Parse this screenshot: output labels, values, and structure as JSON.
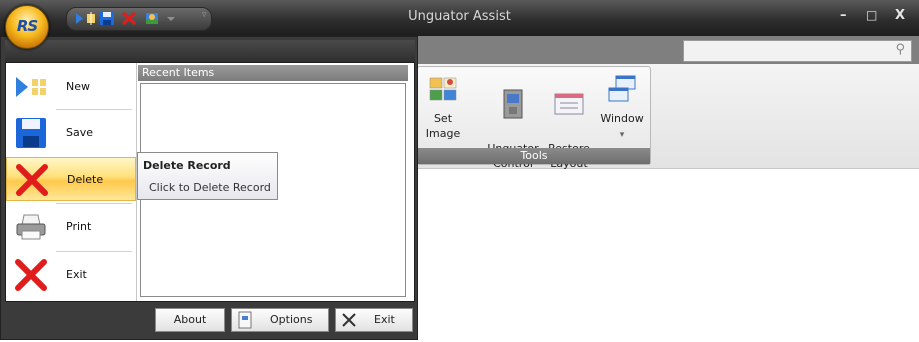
{
  "window": {
    "title": "Unguator Assist",
    "logo_text": "RS",
    "controls": [
      "minimize-icon",
      "maximize-icon",
      "close-icon"
    ],
    "minimize": "–",
    "maximize": "□",
    "close": "X"
  },
  "quick_access": [
    "new-icon",
    "save-icon",
    "delete-icon",
    "set-image-icon",
    "dropdown-arrow-icon",
    "customize-icon"
  ],
  "search": {
    "value": "",
    "icon": "search-icon"
  },
  "ribbon": {
    "group_label": "Tools",
    "buttons": [
      {
        "label": "Set Image",
        "icon": "set-image-icon"
      },
      {
        "label": "Unguator\nControl",
        "icon": "unguator-control-icon"
      },
      {
        "label": "Restore\nLayout",
        "icon": "restore-layout-icon"
      },
      {
        "label": "Window",
        "icon": "window-icon",
        "dropdown": "▾"
      }
    ]
  },
  "app_menu": {
    "commands": [
      {
        "label": "New",
        "icon": "new-icon"
      },
      {
        "label": "Save",
        "icon": "save-icon"
      },
      {
        "label": "Delete",
        "icon": "delete-icon",
        "active": true
      },
      {
        "label": "Print",
        "icon": "print-icon"
      },
      {
        "label": "Exit",
        "icon": "exit-icon"
      }
    ],
    "recent_header": "Recent Items",
    "footer": {
      "about": "About",
      "options": "Options",
      "exit": "Exit"
    }
  },
  "tooltip": {
    "title": "Delete Record",
    "body": "Click to Delete Record"
  },
  "colors": {
    "titlebar": "#2e2e2e",
    "menu_bg": "#3b3b3b",
    "active": "#ffd34a",
    "accent_blue": "#1a5fc8",
    "delete_red": "#e11c1c"
  }
}
